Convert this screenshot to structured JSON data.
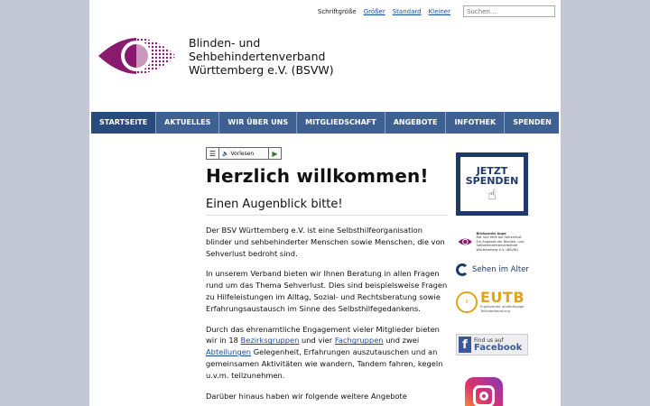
{
  "topbar": {
    "font_size_label": "Schriftgröße",
    "larger": "Größer",
    "standard": "Standard",
    "smaller": "Kleiner",
    "search_placeholder": "Suchen..."
  },
  "org": {
    "line1": "Blinden- und",
    "line2": "Sehbehindertenverband",
    "line3": "Württemberg e.V. (BSVW)"
  },
  "nav": {
    "items": [
      "STARTSEITE",
      "AKTUELLES",
      "WIR ÜBER UNS",
      "MITGLIEDSCHAFT",
      "ANGEBOTE",
      "INFOTHEK",
      "SPENDEN"
    ]
  },
  "readspeaker": {
    "label": "Vorlesen"
  },
  "main": {
    "title": "Herzlich willkommen!",
    "subtitle": "Einen Augenblick bitte!",
    "p1": "Der BSV Württemberg e.V. ist eine Selbsthilfeorganisation blinder und sehbehinderter Menschen sowie Menschen, die von Sehverlust bedroht sind.",
    "p2": "In unserem Verband bieten wir Ihnen Beratung in allen Fragen rund um das Thema Sehverlust. Dies sind beispielsweise Fragen zu Hilfeleistungen im Alltag, Sozial- und Rechtsberatung sowie Erfahrungsaustausch im Sinne des Selbsthilfegedankens.",
    "p3_a": "Durch das ehrenamtliche Engagement vieler Mitglieder bieten wir in 18 ",
    "p3_link1": "Bezirksgruppen",
    "p3_b": " und vier ",
    "p3_link2": "Fachgruppen",
    "p3_c": " und zwei ",
    "p3_link3": "Abteilungen",
    "p3_d": " Gelegenheit, Erfahrungen auszutauschen und an gemeinsamen Aktivitäten wie wandern, Tandem fahren, kegeln u.v.m. teilzunehmen.",
    "p4": "Darüber hinaus haben wir folgende weitere Angebote"
  },
  "sidebar": {
    "spenden_line1": "JETZT",
    "spenden_line2": "SPENDEN",
    "blick_title": "Blickpunkt Auge",
    "blick_sub": "Rat und Hilfe bei Sehverlust",
    "blick_desc": "Ein Angebot der Blinden- und Sehbehindertenverbände",
    "blick_org": "Württemberg e.V. (BSVW)",
    "alter": "Sehen im Alter",
    "eutb": "EUTB",
    "eutb_sub1": "Ergänzende unabhängige",
    "eutb_sub2": "Teilhabeberatung",
    "fb_line1": "Find us auf",
    "fb_line2": "Facebook"
  },
  "colors": {
    "nav_bg": "#3e6192",
    "nav_active": "#294a7c",
    "logo_purple": "#8a1a6e",
    "link": "#1a4a9a",
    "page_bg": "#c4c8d6"
  }
}
